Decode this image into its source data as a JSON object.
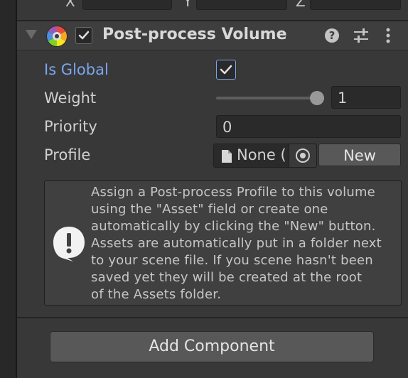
{
  "transform_row": {
    "x_label": "X",
    "y_label": "Y",
    "z_label": "Z"
  },
  "component": {
    "title": "Post-process Volume",
    "enabled": true,
    "icons": [
      "help-icon",
      "preset-icon",
      "kebab-menu-icon"
    ]
  },
  "properties": {
    "is_global": {
      "label": "Is Global",
      "checked": true
    },
    "weight": {
      "label": "Weight",
      "value": "1",
      "slider_fraction": 1.0
    },
    "priority": {
      "label": "Priority",
      "value": "0"
    },
    "profile": {
      "label": "Profile",
      "value": "None (",
      "new_button": "New"
    }
  },
  "help_box": {
    "text": "Assign a Post-process Profile to this volume\nusing the \"Asset\" field or create one\nautomatically by clicking the \"New\" button.\nAssets are automatically put in a folder next\nto your scene file. If you scene hasn't been\nsaved yet they will be created at the root\nof the Assets folder."
  },
  "add_component_label": "Add Component",
  "colors": {
    "background": "#383838",
    "accent_blue": "#7aa6ee",
    "field_bg": "#2a2a2a",
    "button_bg": "#585858"
  }
}
